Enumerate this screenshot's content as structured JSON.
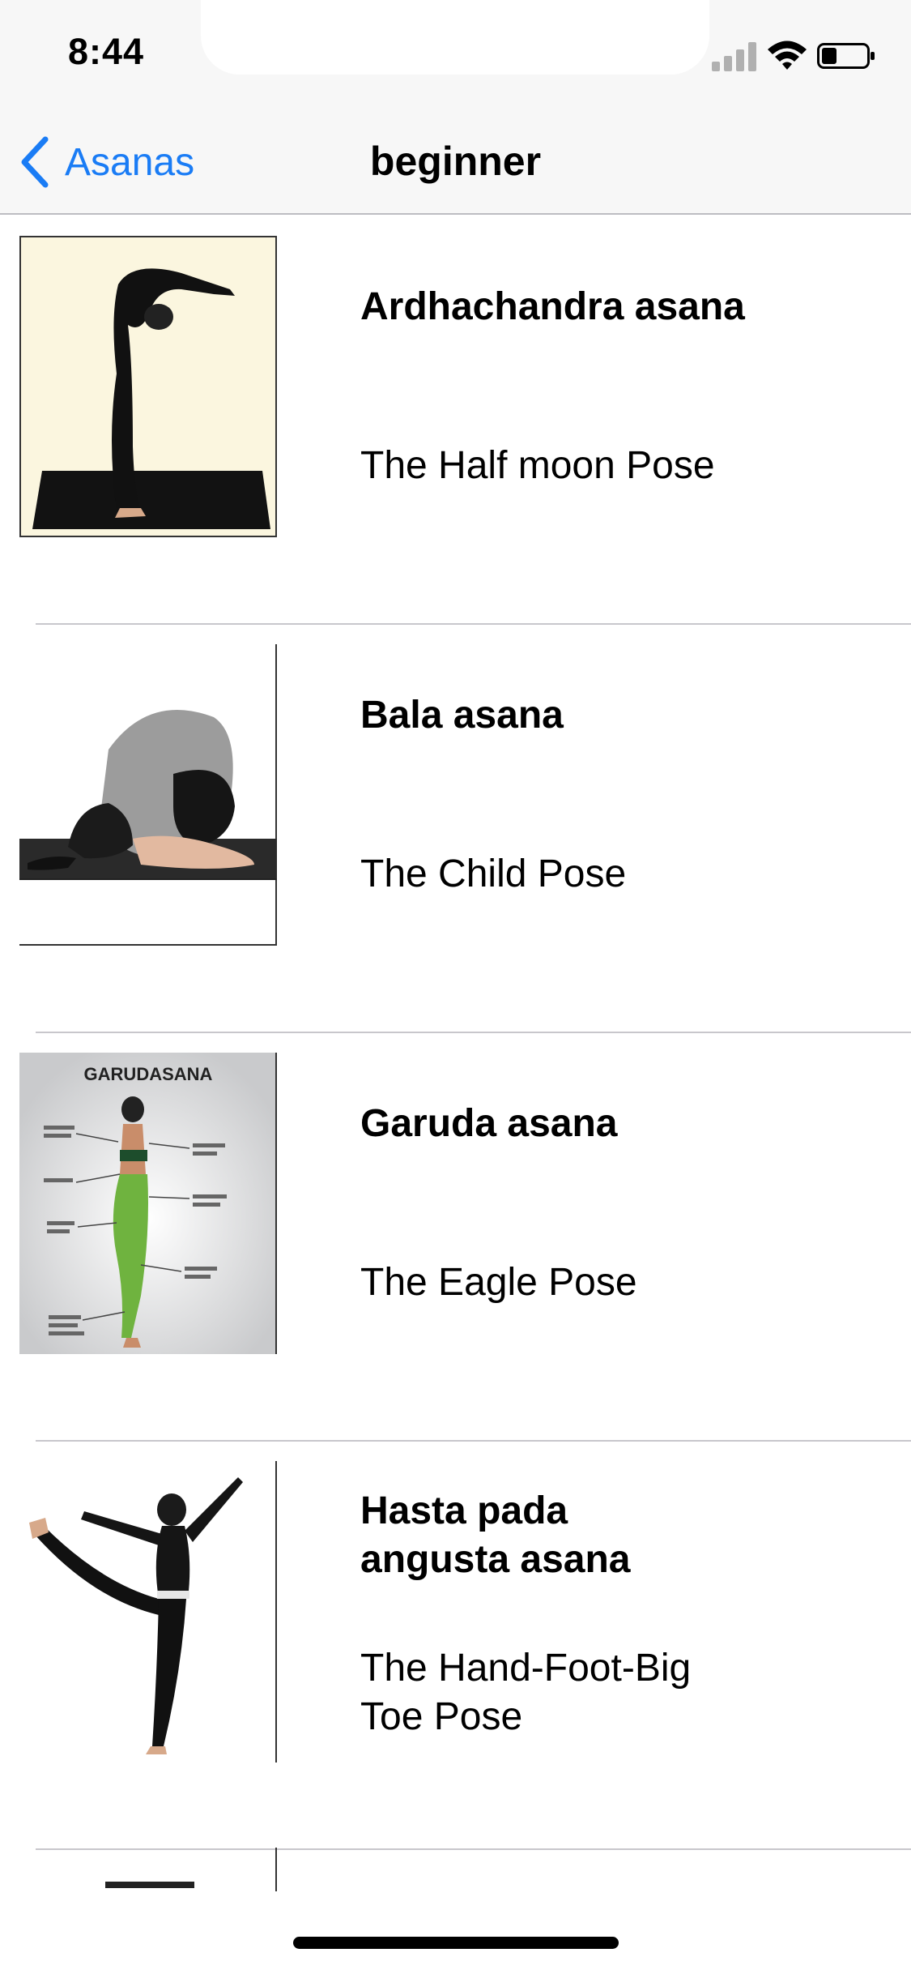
{
  "status_bar": {
    "time": "8:44"
  },
  "nav": {
    "back_label": "Asanas",
    "title": "beginner"
  },
  "rows": [
    {
      "title": "Ardhachandra asana",
      "subtitle": "The Half  moon Pose",
      "image": "half-moon-pose-image"
    },
    {
      "title": "Bala asana",
      "subtitle": "The Child Pose",
      "image": "child-pose-image"
    },
    {
      "title": "Garuda  asana",
      "subtitle": "The Eagle Pose",
      "image": "eagle-pose-image",
      "image_caption": "GARUDASANA"
    },
    {
      "title": "Hasta  pada\nangusta  asana",
      "subtitle": "The Hand-Foot-Big\nToe Pose",
      "image": "hand-foot-big-toe-pose-image"
    }
  ],
  "colors": {
    "accent": "#1a7cf5",
    "nav_background": "#f7f7f7",
    "separator": "#c8c7cc"
  }
}
